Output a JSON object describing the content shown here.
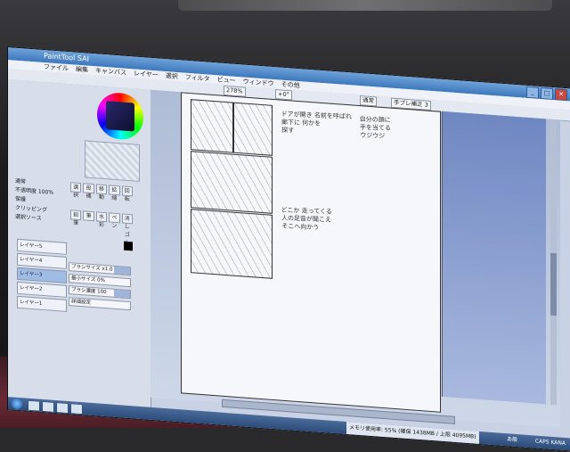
{
  "app": {
    "title": "PaintTool SAI",
    "menu": [
      "ファイル",
      "編集",
      "キャンバス",
      "レイヤー",
      "選択",
      "フィルタ",
      "ビュー",
      "ウィンドウ",
      "その他"
    ]
  },
  "toolbar": {
    "zoom": "278%",
    "angle": "+0°",
    "mode": "通常",
    "stabilizer": "手ブレ補正 3"
  },
  "left_panel": {
    "rows": [
      "通常",
      "不透明度 100%",
      "保護",
      "クリッピング",
      "選択ソース"
    ],
    "tools": [
      "選択",
      "投縄",
      "移動",
      "拡縮",
      "回転",
      "鉛筆",
      "筆",
      "水彩",
      "ペン",
      "消しゴム"
    ],
    "layers": [
      "レイヤー5",
      "レイヤー4",
      "レイヤー3",
      "レイヤー2",
      "レイヤー1"
    ],
    "sliders": [
      "ブラシサイズ x1.0 5.0",
      "最小サイズ 0%",
      "ブラシ濃度 100",
      "詳細設定"
    ],
    "swatch_colors": [
      "#000000",
      "#ffffff",
      "#d28bd8"
    ]
  },
  "canvas": {
    "notes": [
      "ドアが開き 名前を呼ばれ\n廊下に 何かを\n探す",
      "自分の顔に\n手を当てる\nウジウジ",
      "どこか 走ってくる\n人の足音が聞こえ\nそこへ向かう"
    ]
  },
  "taskbar": {
    "status": "メモリ使用率: 55% (確保 1438MB / 上限 4095MB)",
    "tray": "CAPS KANA",
    "lang": "あ般"
  },
  "colors": {
    "titlebar": "#3d78bd",
    "canvas_bg": "#aebcd6",
    "laptop": "#6a2a35"
  }
}
